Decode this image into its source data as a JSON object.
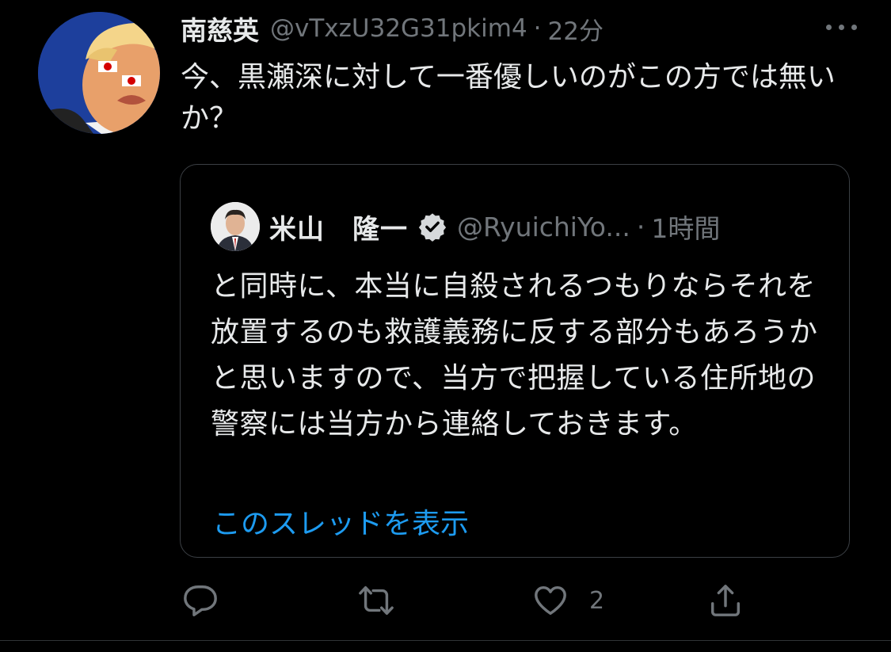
{
  "tweet": {
    "author_name": "南慈英",
    "author_handle": "@vTxzU32G31pkim4",
    "separator": "·",
    "time": "22分",
    "text": "今、黒瀬深に対して一番優しいのがこの方では無いか？"
  },
  "quoted": {
    "author_name": "米山　隆一",
    "author_handle": "@RyuichiYo...",
    "separator": "·",
    "time": "1時間",
    "text": "と同時に、本当に自殺されるつもりならそれを放置するのも救護義務に反する部分もあろうかと思いますので、当方で把握している住所地の警察には当方から連絡しておきます。",
    "thread_link": "このスレッドを表示"
  },
  "actions": {
    "like_count": "2"
  },
  "icons": {
    "more": "more-horizontal-icon",
    "verified": "verified-badge-icon",
    "reply": "reply-icon",
    "retweet": "retweet-icon",
    "like": "like-icon",
    "share": "share-icon"
  },
  "colors": {
    "background": "#000000",
    "text": "#e7e9ea",
    "muted": "#71767b",
    "link": "#1d9bf0",
    "border": "#3b3f44"
  }
}
